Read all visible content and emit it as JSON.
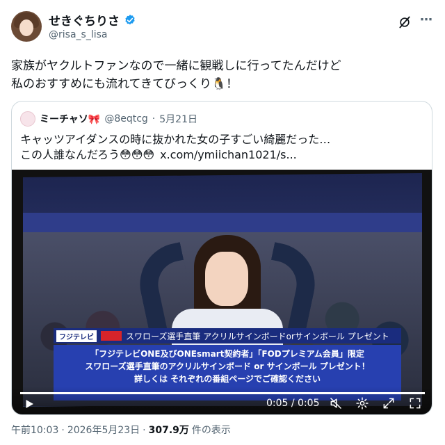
{
  "author": {
    "display_name": "せきぐちりさ",
    "handle": "@risa_s_lisa",
    "verified_icon": "verified-badge-icon"
  },
  "tweet": {
    "text": "家族がヤクルトファンなので一緒に観戦しに行ってたんだけど\n私のおすすめにも流れてきてびっくり🐧！"
  },
  "quote": {
    "display_name": "ミーチャソ",
    "name_emoji": "🎀",
    "handle": "@8eqtcg",
    "separator": "·",
    "date": "5月21日",
    "text": "キャッツアイダンスの時に抜かれた女の子すごい綺麗だった…\nこの人誰なんだろう😳😳😳",
    "link": "x.com/ymiichan1021/s..."
  },
  "video": {
    "tv_logo": "フジテレビ",
    "tv_headline": "スワローズ選手直筆 アクリルサインボードorサインボール プレゼント",
    "tv_body": "「フジテレビONE及びONEsmart契約者」「FODプレミアム会員」限定\nスワローズ選手直筆のアクリルサインボード or サインボール プレゼント！\n詳しくは それぞれの番組ページでご確認ください",
    "time": "0:05 / 0:05",
    "progress": 1.0
  },
  "meta": {
    "time": "午前10:03",
    "separator": "·",
    "date": "2026年5月23日",
    "views": "307.9万",
    "views_label": "件の表示"
  },
  "colors": {
    "accent": "#1d9bf0",
    "text": "#0f1419",
    "muted": "#536471",
    "border": "#cfd9de"
  }
}
